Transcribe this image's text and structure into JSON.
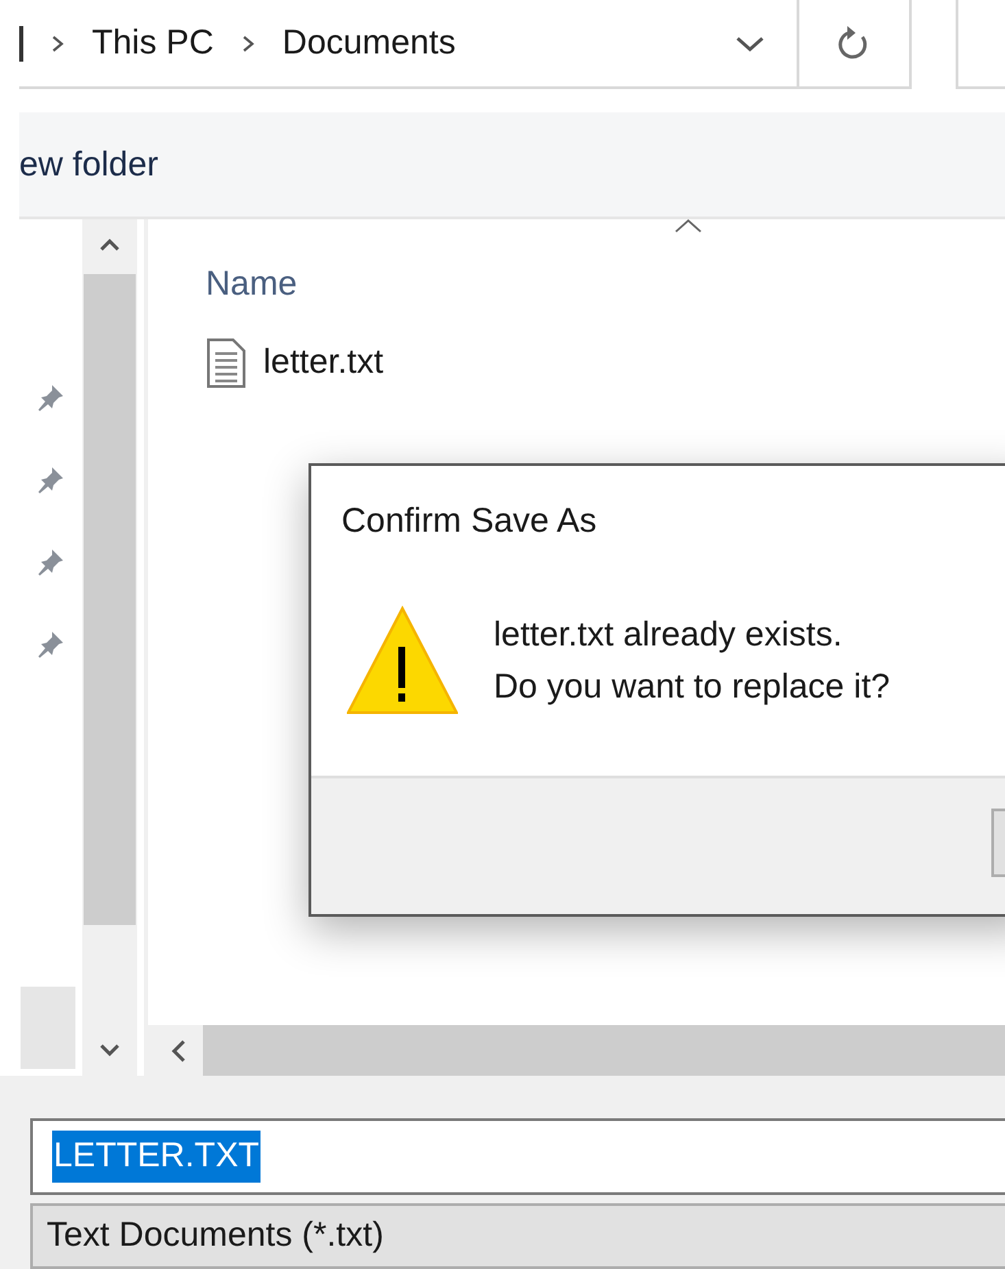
{
  "address_bar": {
    "path": [
      "This PC",
      "Documents"
    ]
  },
  "toolbar": {
    "new_folder": "ew folder"
  },
  "file_list": {
    "columns": [
      {
        "label": "Name",
        "sorted_ascending": true
      }
    ],
    "files": [
      {
        "name": "letter.txt"
      }
    ]
  },
  "dialog": {
    "title": "Confirm Save As",
    "message": [
      "letter.txt already exists.",
      "Do you want to replace it?"
    ]
  },
  "file_name": {
    "value": "LETTER.TXT",
    "selected": true
  },
  "save_as_type": {
    "value": "Text Documents (*.txt)"
  }
}
